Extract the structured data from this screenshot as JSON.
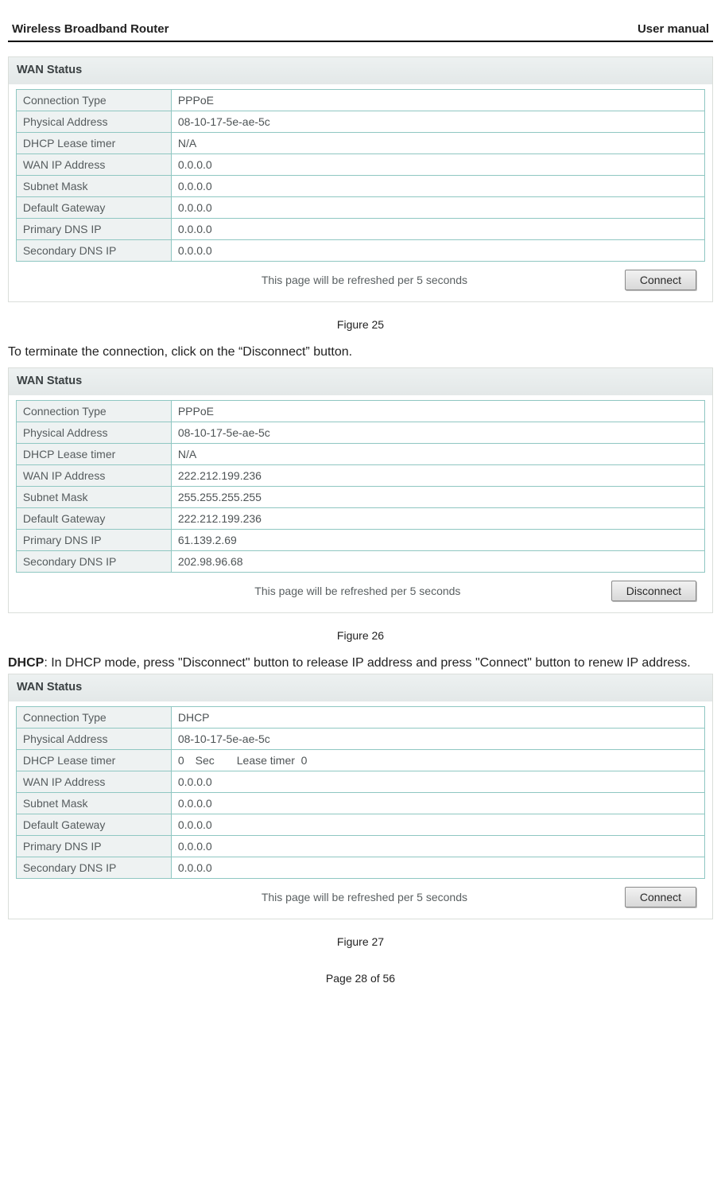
{
  "header": {
    "left": "Wireless Broadband Router",
    "right": "User manual"
  },
  "footer": "Page 28 of 56",
  "panels": {
    "p1": {
      "title": "WAN Status",
      "rows": [
        [
          "Connection Type",
          "PPPoE"
        ],
        [
          "Physical Address",
          "08-10-17-5e-ae-5c"
        ],
        [
          "DHCP Lease timer",
          "N/A"
        ],
        [
          "WAN IP Address",
          "0.0.0.0"
        ],
        [
          "Subnet Mask",
          "0.0.0.0"
        ],
        [
          "Default Gateway",
          "0.0.0.0"
        ],
        [
          "Primary DNS IP",
          "0.0.0.0"
        ],
        [
          "Secondary DNS IP",
          "0.0.0.0"
        ]
      ],
      "refresh": "This page will be refreshed per 5 seconds",
      "button": "Connect",
      "caption": "Figure 25"
    },
    "para1": "To terminate the connection, click on the “Disconnect” button.",
    "p2": {
      "title": "WAN Status",
      "rows": [
        [
          "Connection Type",
          "PPPoE"
        ],
        [
          "Physical Address",
          "08-10-17-5e-ae-5c"
        ],
        [
          "DHCP Lease timer",
          "N/A"
        ],
        [
          "WAN IP Address",
          "222.212.199.236"
        ],
        [
          "Subnet Mask",
          "255.255.255.255"
        ],
        [
          "Default Gateway",
          "222.212.199.236"
        ],
        [
          "Primary DNS IP",
          "61.139.2.69"
        ],
        [
          "Secondary DNS IP",
          "202.98.96.68"
        ]
      ],
      "refresh": "This page will be refreshed per 5 seconds",
      "button": "Disconnect",
      "caption": "Figure 26"
    },
    "para2_bold": "DHCP",
    "para2_rest": ": In DHCP mode, press \"Disconnect\" button to release IP address and press \"Connect\" button to renew IP address.",
    "p3": {
      "title": "WAN Status",
      "rows": [
        [
          "Connection Type",
          "DHCP"
        ],
        [
          "Physical Address",
          "08-10-17-5e-ae-5c"
        ],
        [
          "DHCP Lease timer",
          "0 Sec  Lease timer  0"
        ],
        [
          "WAN IP Address",
          "0.0.0.0"
        ],
        [
          "Subnet Mask",
          "0.0.0.0"
        ],
        [
          "Default Gateway",
          "0.0.0.0"
        ],
        [
          "Primary DNS IP",
          "0.0.0.0"
        ],
        [
          "Secondary DNS IP",
          "0.0.0.0"
        ]
      ],
      "refresh": "This page will be refreshed per 5 seconds",
      "button": "Connect",
      "caption": "Figure 27"
    }
  }
}
